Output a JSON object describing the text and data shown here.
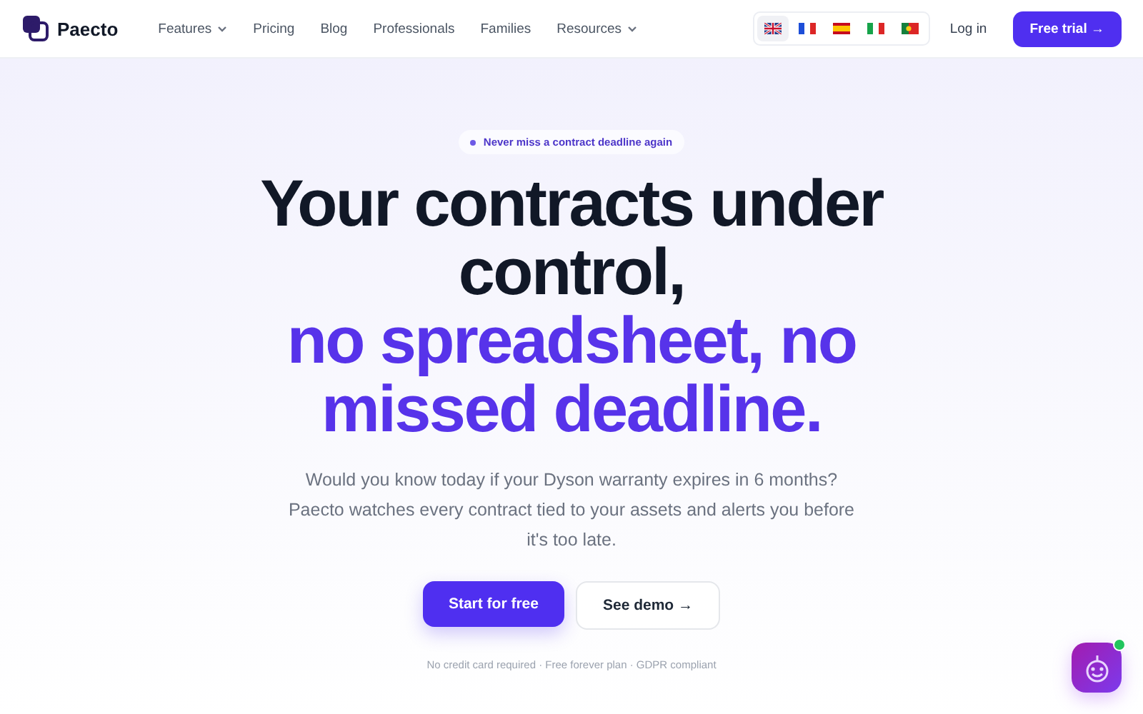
{
  "brand": {
    "name": "Paecto"
  },
  "nav": [
    {
      "label": "Features",
      "dropdown": true
    },
    {
      "label": "Pricing",
      "dropdown": false
    },
    {
      "label": "Blog",
      "dropdown": false
    },
    {
      "label": "Professionals",
      "dropdown": false
    },
    {
      "label": "Families",
      "dropdown": false
    },
    {
      "label": "Resources",
      "dropdown": true
    }
  ],
  "languages": [
    {
      "kind": "uk",
      "selected": true
    },
    {
      "kind": "fr",
      "selected": false
    },
    {
      "kind": "es",
      "selected": false
    },
    {
      "kind": "it",
      "selected": false
    },
    {
      "kind": "pt",
      "selected": false
    }
  ],
  "login": "Log in",
  "cta": "Free trial →",
  "hero": {
    "badge": "Never miss a contract deadline again",
    "title": "Your contracts under control,",
    "title_accent": "no spreadsheet, no missed deadline.",
    "subtitle": "Would you know today if your Dyson warranty expires in 6 months? Paecto watches every contract tied to your assets and alerts you before it's too late.",
    "primary_button": "Start for free",
    "secondary_button": "See demo →",
    "footnote": "No credit card required · Free forever plan · GDPR compliant"
  },
  "chat_widget": {
    "online": true
  }
}
